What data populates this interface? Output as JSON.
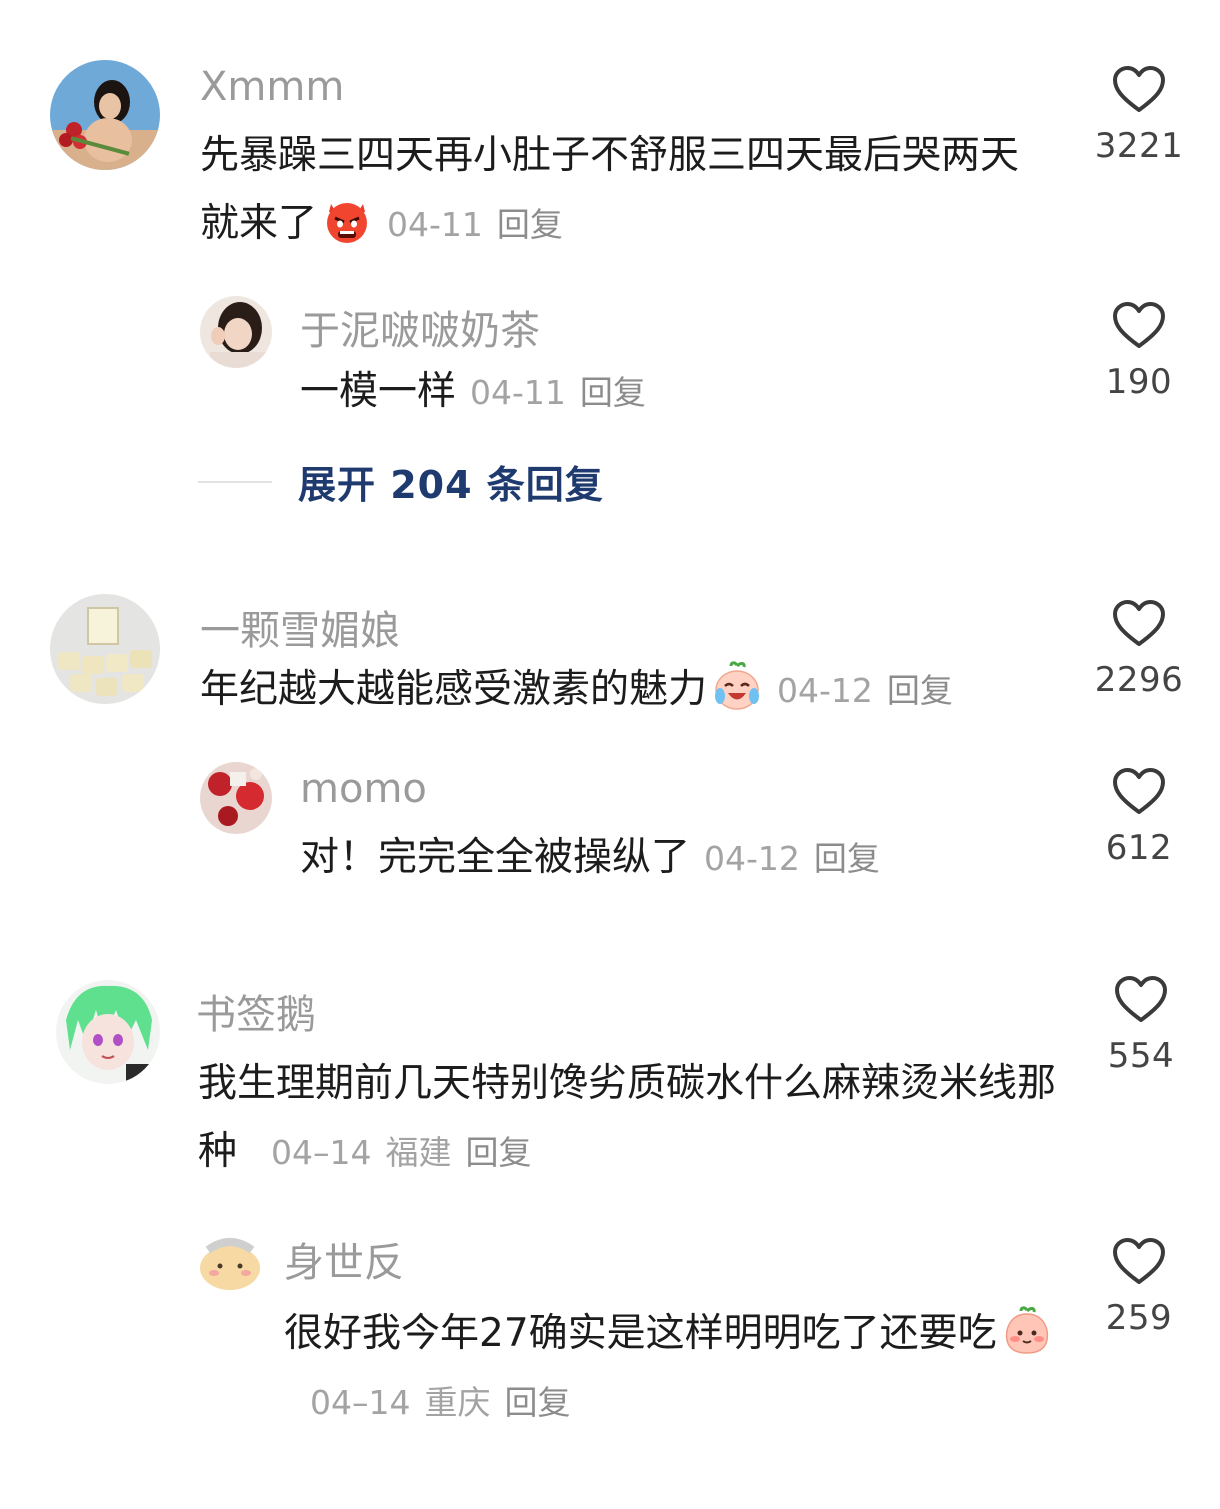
{
  "threads": [
    {
      "comment": {
        "username": "Xmmm",
        "text": "先暴躁三四天再小肚子不舒服三四天最后哭两天就来了",
        "emoji": "angry-devil-emoji",
        "date": "04-11",
        "location": "",
        "reply": "回复",
        "likes": "3221"
      },
      "reply": {
        "username": "于泥啵啵奶茶",
        "text": "一模一样",
        "date": "04-11",
        "location": "",
        "reply": "回复",
        "likes": "190"
      },
      "expand": "展开 204 条回复"
    },
    {
      "comment": {
        "username": "一颗雪媚娘",
        "text": "年纪越大越能感受激素的魅力",
        "emoji": "crying-laugh-emoji",
        "date": "04-12",
        "location": "",
        "reply": "回复",
        "likes": "2296"
      },
      "reply": {
        "username": "momo",
        "text": "对！完完全全被操纵了",
        "date": "04-12",
        "location": "",
        "reply": "回复",
        "likes": "612"
      }
    },
    {
      "comment": {
        "username": "书签鹅",
        "text": "我生理期前几天特别馋劣质碳水什么麻辣烫米线那种",
        "date": "04–14",
        "location": "福建",
        "reply": "回复",
        "likes": "554"
      },
      "reply": {
        "username": "身世反",
        "text": "很好我今年27确实是这样明明吃了还要吃",
        "emoji": "shy-peach-emoji",
        "date": "04–14",
        "location": "重庆",
        "reply": "回复",
        "likes": "259"
      }
    }
  ],
  "colors": {
    "username": "#9a9a9a",
    "text": "#1c1c1c",
    "meta": "#a3a3a3",
    "expand": "#1e3a6e",
    "heart": "#3a3a3a"
  }
}
